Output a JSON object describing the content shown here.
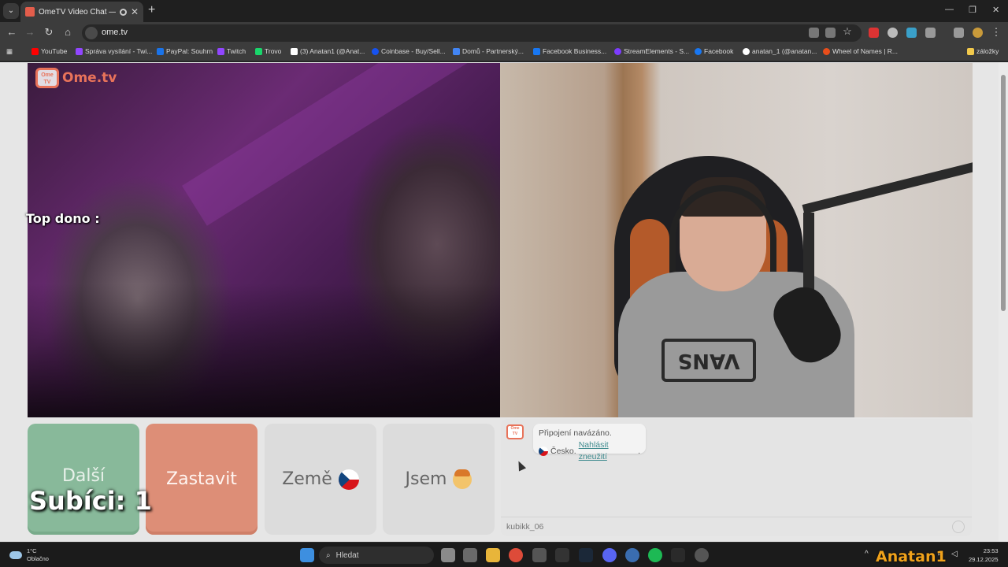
{
  "browser": {
    "tab_title": "OmeTV Video Chat — Ome",
    "url": "ome.tv",
    "bookmarks": [
      {
        "label": "YouTube",
        "color": "#ff0000"
      },
      {
        "label": "Správa vysílání - Twi...",
        "color": "#9146ff"
      },
      {
        "label": "PayPal: Souhrn",
        "color": "#1a73e8"
      },
      {
        "label": "Twitch",
        "color": "#9146ff"
      },
      {
        "label": "Trovo",
        "color": "#19d66b"
      },
      {
        "label": "(3) Anatan1 (@Anat...",
        "color": "#ffffff"
      },
      {
        "label": "Coinbase - Buy/Sell...",
        "color": "#1652f0"
      },
      {
        "label": "Domů - Partnerský...",
        "color": "#4285f4"
      },
      {
        "label": "Facebook Business...",
        "color": "#1877f2"
      },
      {
        "label": "StreamElements - S...",
        "color": "#7d3cff"
      },
      {
        "label": "Facebook",
        "color": "#1877f2"
      },
      {
        "label": "anatan_1 (@anatan...",
        "color": "#ffffff"
      },
      {
        "label": "Wheel of Names | R...",
        "color": "#e94e1b"
      },
      {
        "label": "záložky",
        "color": "#f2c94c"
      }
    ]
  },
  "page": {
    "logo_text": "Ome.tv",
    "logo_badge": "Ome TV",
    "overlay_top_dono": "Top dono :",
    "overlay_subs": "Subíci: 1",
    "controls": {
      "next": "Další",
      "stop": "Zastavit",
      "country": "Země",
      "me": "Jsem"
    },
    "chat": {
      "system_line1": "Připojení navázáno.",
      "system_country": "Česko.",
      "report_link": "Nahlásit zneužití",
      "report_suffix": ".",
      "input_value": "kubikk_06"
    }
  },
  "taskbar": {
    "weather_temp": "1°C",
    "weather_text": "Oblačno",
    "search_placeholder": "Hledat",
    "time": "23:53",
    "date": "29.12.2025"
  },
  "watermark": "Anatan1",
  "colors": {
    "next_button": "#88b99a",
    "stop_button": "#dd8e77",
    "brand": "#e8735a",
    "link": "#3f8b8e"
  },
  "icons": [
    "search-icon",
    "windows-start-icon",
    "czech-flag-icon",
    "boy-emoji-icon",
    "emoji-icon",
    "wifi-icon",
    "speaker-icon"
  ]
}
